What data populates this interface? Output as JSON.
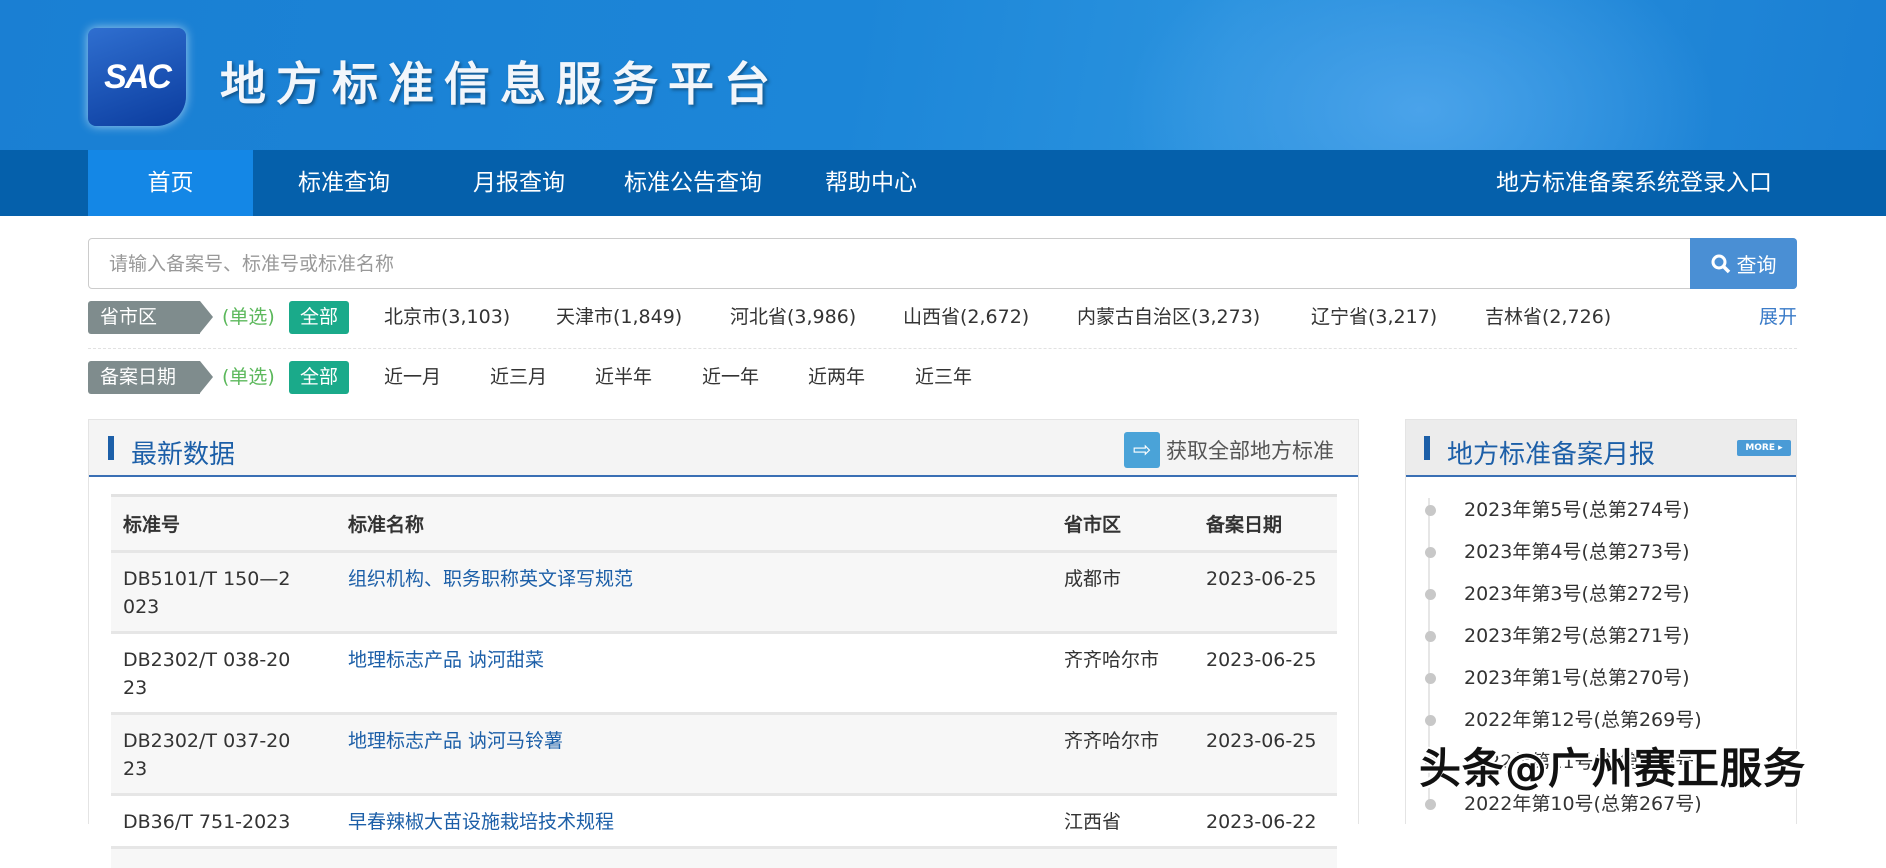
{
  "header": {
    "logo_text": "SAC",
    "site_title": "地方标准信息服务平台"
  },
  "nav": {
    "items": [
      {
        "label": "首页",
        "active": true
      },
      {
        "label": "标准查询"
      },
      {
        "label": "月报查询"
      },
      {
        "label": "标准公告查询"
      },
      {
        "label": "帮助中心"
      }
    ],
    "login": "地方标准备案系统登录入口"
  },
  "search": {
    "placeholder": "请输入备案号、标准号或标准名称",
    "value": "",
    "button": "查询",
    "icon": "search-icon"
  },
  "filters": {
    "region": {
      "label": "省市区",
      "mode": "(单选)",
      "all": "全部",
      "options": [
        "北京市(3,103)",
        "天津市(1,849)",
        "河北省(3,986)",
        "山西省(2,672)",
        "内蒙古自治区(3,273)",
        "辽宁省(3,217)",
        "吉林省(2,726)"
      ],
      "expand": "展开"
    },
    "date": {
      "label": "备案日期",
      "mode": "(单选)",
      "all": "全部",
      "options": [
        "近一月",
        "近三月",
        "近半年",
        "近一年",
        "近两年",
        "近三年"
      ]
    }
  },
  "latest": {
    "title": "最新数据",
    "get_all": "获取全部地方标准",
    "columns": [
      "标准号",
      "标准名称",
      "省市区",
      "备案日期"
    ],
    "rows": [
      [
        "DB5101/T 150—2023",
        "组织机构、职务职称英文译写规范",
        "成都市",
        "2023-06-25"
      ],
      [
        "DB2302/T 038-2023",
        "地理标志产品 讷河甜菜",
        "齐齐哈尔市",
        "2023-06-25"
      ],
      [
        "DB2302/T 037-2023",
        "地理标志产品 讷河马铃薯",
        "齐齐哈尔市",
        "2023-06-25"
      ],
      [
        "DB36/T 751-2023",
        "早春辣椒大苗设施栽培技术规程",
        "江西省",
        "2023-06-22"
      ]
    ]
  },
  "monthly": {
    "title": "地方标准备案月报",
    "more": "MORE ▸",
    "items": [
      "2023年第5号(总第274号)",
      "2023年第4号(总第273号)",
      "2023年第3号(总第272号)",
      "2023年第2号(总第271号)",
      "2023年第1号(总第270号)",
      "2022年第12号(总第269号)",
      "2022年第11号(总第268号)",
      "2022年第10号(总第267号)"
    ]
  },
  "watermark": "头条@广州赛正服务",
  "colors": {
    "banner": "#1a7fd3",
    "nav": "#0560ab",
    "nav_active": "#1487e6",
    "link": "#1c5fa8",
    "tag_all": "#1aaa8a",
    "search_button": "#4a8fd4"
  }
}
